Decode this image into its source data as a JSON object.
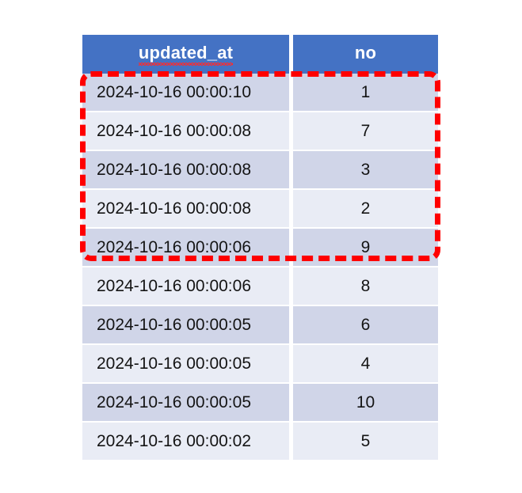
{
  "table": {
    "columns": [
      {
        "key": "updated_at",
        "label": "updated_at",
        "align": "left",
        "misspelled": true
      },
      {
        "key": "no",
        "label": "no",
        "align": "center",
        "misspelled": false
      }
    ],
    "rows": [
      {
        "updated_at": "2024-10-16 00:00:10",
        "no": "1"
      },
      {
        "updated_at": "2024-10-16 00:00:08",
        "no": "7"
      },
      {
        "updated_at": "2024-10-16 00:00:08",
        "no": "3"
      },
      {
        "updated_at": "2024-10-16 00:00:08",
        "no": "2"
      },
      {
        "updated_at": "2024-10-16 00:00:06",
        "no": "9"
      },
      {
        "updated_at": "2024-10-16 00:00:06",
        "no": "8"
      },
      {
        "updated_at": "2024-10-16 00:00:05",
        "no": "6"
      },
      {
        "updated_at": "2024-10-16 00:00:05",
        "no": "4"
      },
      {
        "updated_at": "2024-10-16 00:00:05",
        "no": "10"
      },
      {
        "updated_at": "2024-10-16 00:00:02",
        "no": "5"
      }
    ]
  },
  "annotation": {
    "type": "dashed-rectangle",
    "color": "#FF0000",
    "covers_rows": 5
  },
  "colors": {
    "header_background": "#4472C4",
    "header_text": "#FFFFFF",
    "row_band_dark": "#D0D5E8",
    "row_band_light": "#E9ECF5",
    "cell_text": "#141414",
    "page_background": "#FFFFFF",
    "spellcheck_underline": "#FF2A2A"
  }
}
